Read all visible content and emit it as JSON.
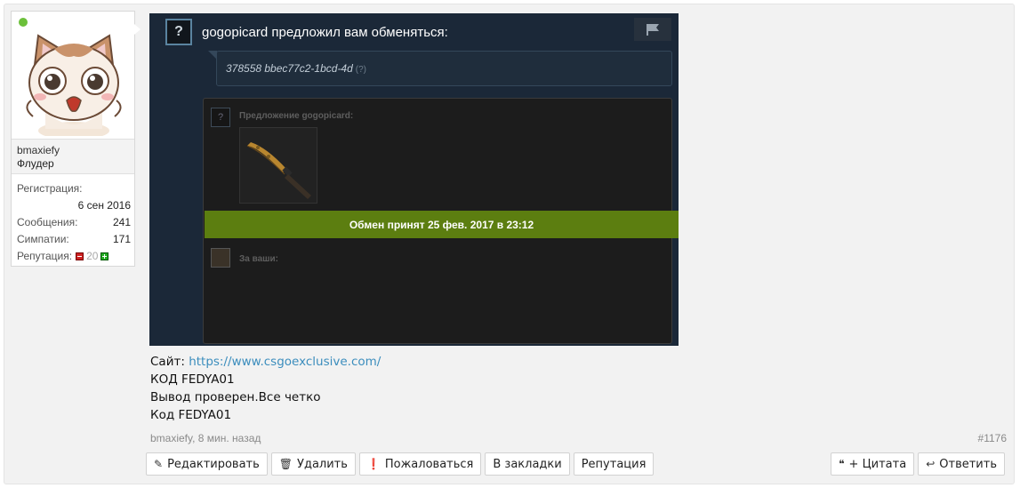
{
  "user": {
    "name": "bmaxiefy",
    "title": "Флудер",
    "stats": {
      "registration_label": "Регистрация:",
      "registration_value": "6 сен 2016",
      "messages_label": "Сообщения:",
      "messages_value": "241",
      "likes_label": "Симпатии:",
      "likes_value": "171",
      "reputation_label": "Репутация:",
      "reputation_value": "20"
    }
  },
  "trade": {
    "header_title": "gogopicard предложил вам обменяться:",
    "message": "378558 bbec77c2-1bcd-4d",
    "message_hint": "(?)",
    "offer_label": "Предложение gogopicard:",
    "accepted_text": "Обмен принят 25 фев. 2017 в 23:12",
    "yours_label": "За ваши:"
  },
  "post": {
    "site_label": "Сайт: ",
    "site_link": "https://www.csgoexclusive.com/",
    "line2": "КОД FEDYA01",
    "line3": "Вывод проверен.Все четко",
    "line4": "Код FEDYA01",
    "meta": "bmaxiefy, 8 мин. назад",
    "number": "#1176"
  },
  "actions": {
    "edit": "Редактировать",
    "delete": "Удалить",
    "report": "Пожаловаться",
    "bookmark": "В закладки",
    "reputation": "Репутация",
    "quote": "+ Цитата",
    "reply": "Ответить"
  },
  "colors": {
    "accepted_bar": "#5c7e10",
    "steam_bg": "#1b2838",
    "link": "#3b8dbd",
    "online": "#6cc03b"
  }
}
